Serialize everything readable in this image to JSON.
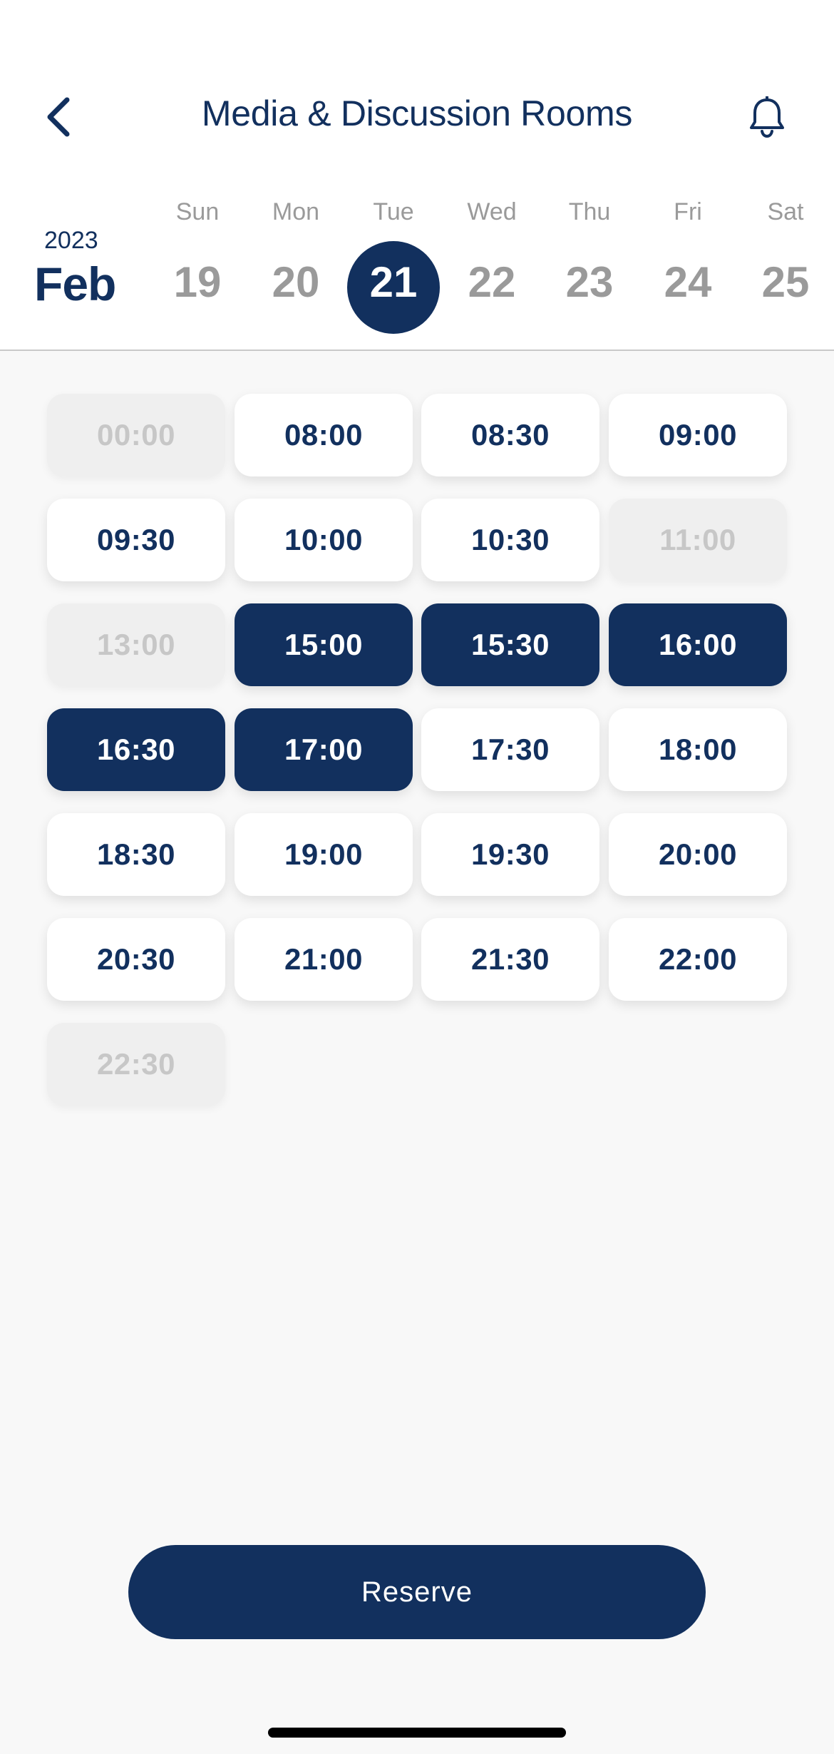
{
  "header": {
    "title": "Media & Discussion Rooms",
    "back_icon": "chevron-left-icon",
    "notification_icon": "bell-icon"
  },
  "calendar": {
    "year": "2023",
    "month": "Feb",
    "days": [
      {
        "name": "Sun",
        "num": "19",
        "selected": false
      },
      {
        "name": "Mon",
        "num": "20",
        "selected": false
      },
      {
        "name": "Tue",
        "num": "21",
        "selected": true
      },
      {
        "name": "Wed",
        "num": "22",
        "selected": false
      },
      {
        "name": "Thu",
        "num": "23",
        "selected": false
      },
      {
        "name": "Fri",
        "num": "24",
        "selected": false
      },
      {
        "name": "Sat",
        "num": "25",
        "selected": false
      }
    ]
  },
  "slots": [
    {
      "time": "00:00",
      "state": "disabled"
    },
    {
      "time": "08:00",
      "state": "available"
    },
    {
      "time": "08:30",
      "state": "available"
    },
    {
      "time": "09:00",
      "state": "available"
    },
    {
      "time": "09:30",
      "state": "available"
    },
    {
      "time": "10:00",
      "state": "available"
    },
    {
      "time": "10:30",
      "state": "available"
    },
    {
      "time": "11:00",
      "state": "disabled"
    },
    {
      "time": "13:00",
      "state": "disabled"
    },
    {
      "time": "15:00",
      "state": "selected"
    },
    {
      "time": "15:30",
      "state": "selected"
    },
    {
      "time": "16:00",
      "state": "selected"
    },
    {
      "time": "16:30",
      "state": "selected"
    },
    {
      "time": "17:00",
      "state": "selected"
    },
    {
      "time": "17:30",
      "state": "available"
    },
    {
      "time": "18:00",
      "state": "available"
    },
    {
      "time": "18:30",
      "state": "available"
    },
    {
      "time": "19:00",
      "state": "available"
    },
    {
      "time": "19:30",
      "state": "available"
    },
    {
      "time": "20:00",
      "state": "available"
    },
    {
      "time": "20:30",
      "state": "available"
    },
    {
      "time": "21:00",
      "state": "available"
    },
    {
      "time": "21:30",
      "state": "available"
    },
    {
      "time": "22:00",
      "state": "available"
    },
    {
      "time": "22:30",
      "state": "disabled"
    }
  ],
  "reserve_label": "Reserve",
  "colors": {
    "primary": "#12305e",
    "muted": "#9a9a9a",
    "disabled_bg": "#efefef",
    "disabled_text": "#c7c7c7"
  }
}
